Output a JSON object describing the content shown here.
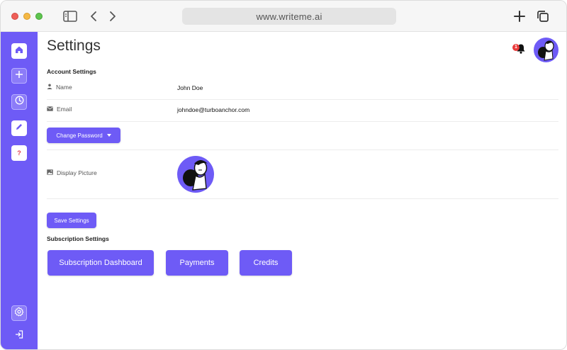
{
  "browser": {
    "url": "www.writeme.ai"
  },
  "sidebar": {
    "items": [
      {
        "name": "home",
        "icon": "home-icon"
      },
      {
        "name": "add",
        "icon": "plus-icon"
      },
      {
        "name": "history",
        "icon": "clock-icon"
      },
      {
        "name": "edit",
        "icon": "pencil-icon"
      },
      {
        "name": "help",
        "icon": "question-icon",
        "label": "?"
      },
      {
        "name": "settings",
        "icon": "gear-icon"
      },
      {
        "name": "logout",
        "icon": "logout-icon"
      }
    ]
  },
  "header": {
    "title": "Settings",
    "notification_count": "1"
  },
  "account": {
    "section_title": "Account Settings",
    "name_label": "Name",
    "name_value": "John Doe",
    "email_label": "Email",
    "email_value": "johndoe@turboanchor.com",
    "change_password_label": "Change Password",
    "display_picture_label": "Display Picture",
    "save_label": "Save Settings"
  },
  "subscription": {
    "section_title": "Subscription Settings",
    "buttons": [
      "Subscription Dashboard",
      "Payments",
      "Credits"
    ]
  },
  "colors": {
    "accent": "#6e5bf6",
    "badge": "#ea3a3a"
  }
}
